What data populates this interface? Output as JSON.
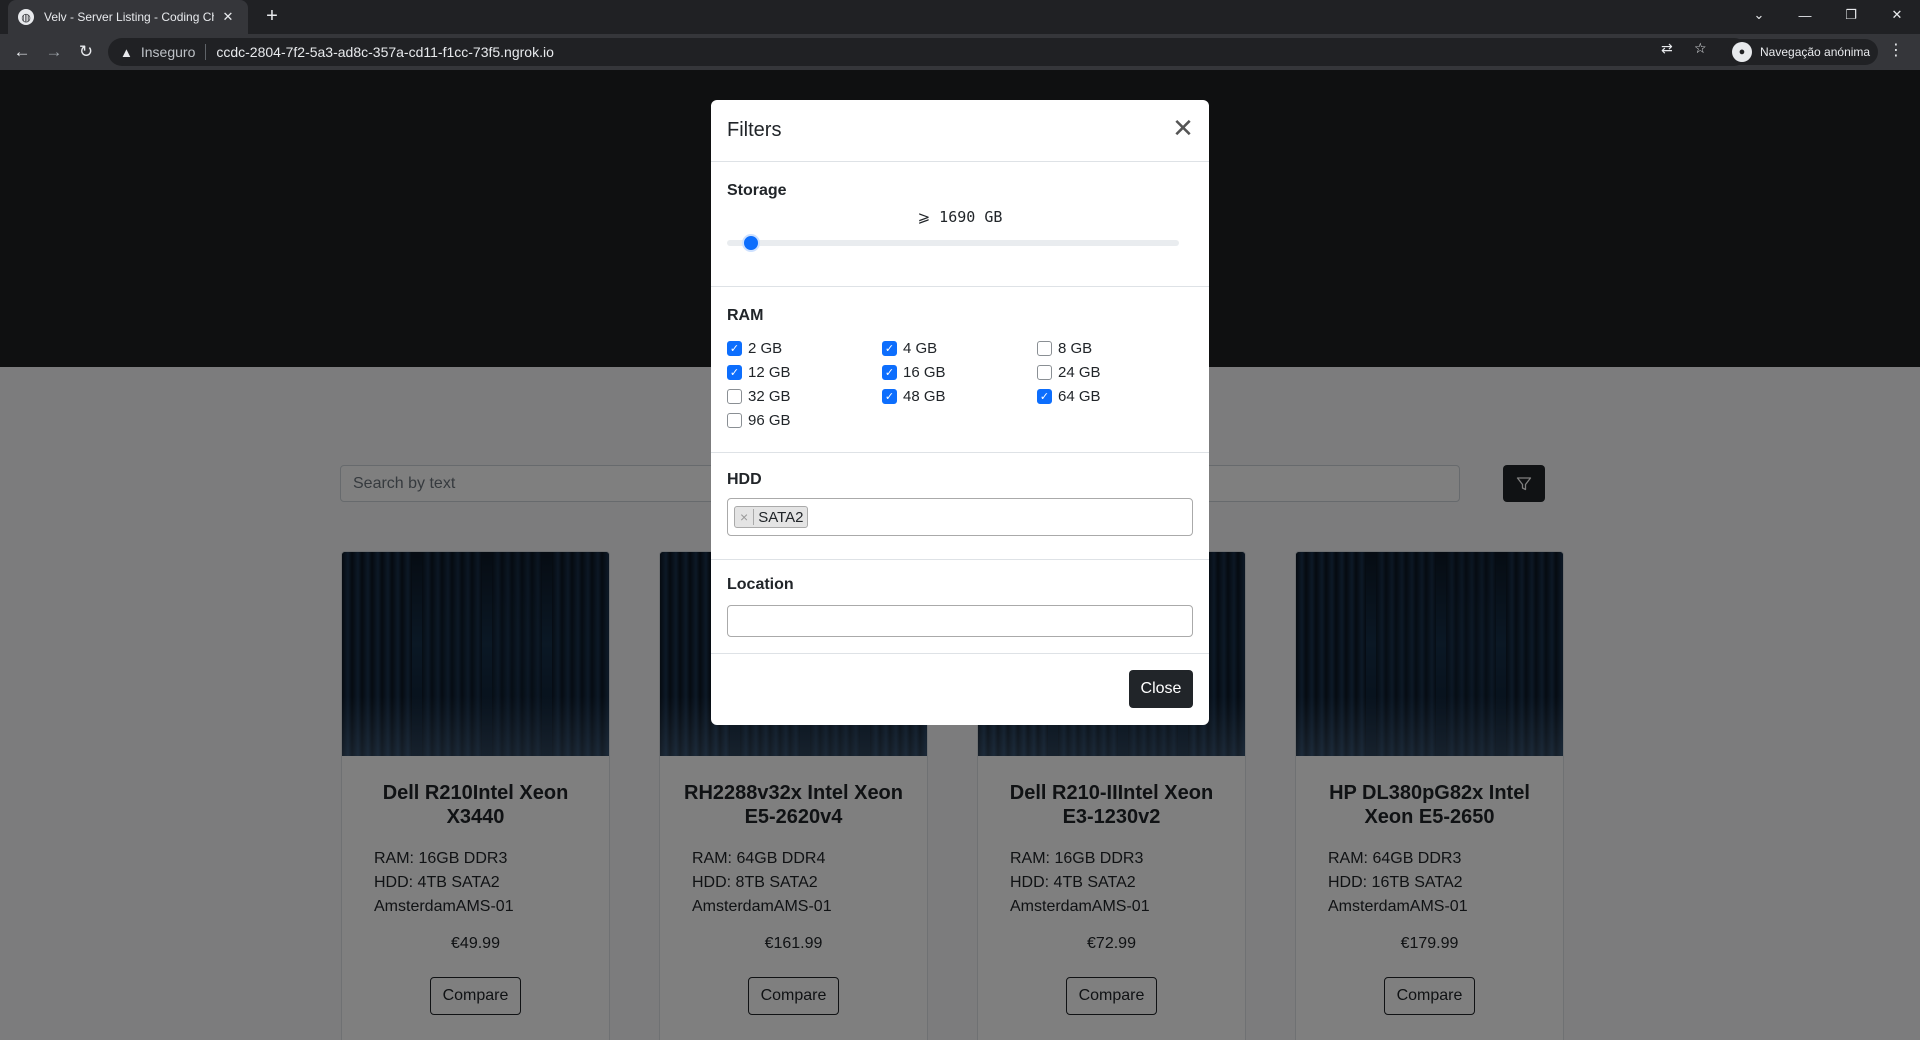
{
  "browser": {
    "tab_title": "Velv - Server Listing - Coding Ch",
    "tab_close": "✕",
    "new_tab": "+",
    "insecure_label": "Inseguro",
    "url": "ccdc-2804-7f2-5a3-ad8c-357a-cd11-f1cc-73f5.ngrok.io",
    "profile_label": "Navegação anónima"
  },
  "search": {
    "placeholder": "Search by text"
  },
  "servers": [
    {
      "name": "Dell R210Intel Xeon X3440",
      "ram": "RAM: 16GB DDR3",
      "hdd": "HDD: 4TB SATA2",
      "location": "AmsterdamAMS-01",
      "price": "€49.99",
      "compare_label": "Compare"
    },
    {
      "name": "RH2288v32x Intel Xeon E5-2620v4",
      "ram": "RAM: 64GB DDR4",
      "hdd": "HDD: 8TB SATA2",
      "location": "AmsterdamAMS-01",
      "price": "€161.99",
      "compare_label": "Compare"
    },
    {
      "name": "Dell R210-IIIntel Xeon E3-1230v2",
      "ram": "RAM: 16GB DDR3",
      "hdd": "HDD: 4TB SATA2",
      "location": "AmsterdamAMS-01",
      "price": "€72.99",
      "compare_label": "Compare"
    },
    {
      "name": "HP DL380pG82x Intel Xeon E5-2650",
      "ram": "RAM: 64GB DDR3",
      "hdd": "HDD: 16TB SATA2",
      "location": "AmsterdamAMS-01",
      "price": "€179.99",
      "compare_label": "Compare"
    }
  ],
  "modal": {
    "title": "Filters",
    "storage": {
      "label": "Storage",
      "value_text": "⩾ 1690 GB",
      "slider_fraction": 0.04
    },
    "ram": {
      "label": "RAM",
      "options": [
        {
          "label": "2 GB",
          "checked": true
        },
        {
          "label": "4 GB",
          "checked": true
        },
        {
          "label": "8 GB",
          "checked": false
        },
        {
          "label": "12 GB",
          "checked": true
        },
        {
          "label": "16 GB",
          "checked": true
        },
        {
          "label": "24 GB",
          "checked": false
        },
        {
          "label": "32 GB",
          "checked": false
        },
        {
          "label": "48 GB",
          "checked": true
        },
        {
          "label": "64 GB",
          "checked": true
        },
        {
          "label": "96 GB",
          "checked": false
        }
      ]
    },
    "hdd": {
      "label": "HDD",
      "selected": [
        "SATA2"
      ],
      "remove_symbol": "×"
    },
    "location": {
      "label": "Location",
      "value": ""
    },
    "close_label": "Close"
  },
  "colors": {
    "accent": "#0d6efd",
    "dark": "#212529",
    "hero": "#1e2022"
  }
}
